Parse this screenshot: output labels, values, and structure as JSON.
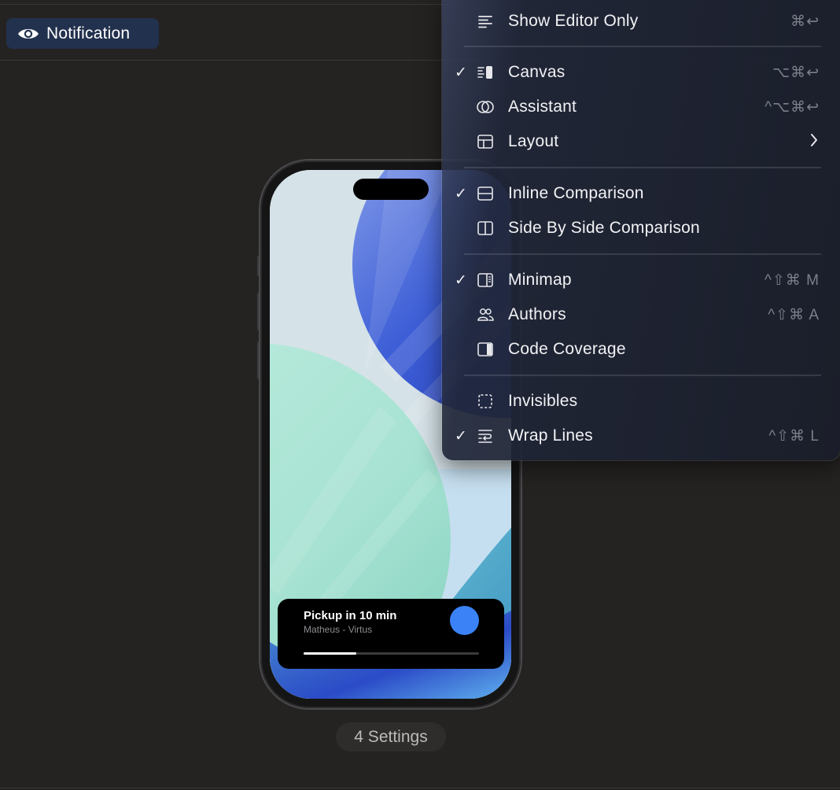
{
  "preview": {
    "mode_label": "Notification",
    "mode_icon": "eye-icon",
    "settings_label": "4 Settings"
  },
  "live_activity": {
    "title": "Pickup in 10 min",
    "subtitle": "Matheus - Virtus",
    "progress_fraction": 0.3,
    "accent_color": "#3b82f6"
  },
  "menu": {
    "items": [
      {
        "label": "Show Editor Only",
        "icon": "editor-lines-icon",
        "checked": false,
        "shortcut": "⌘↩"
      },
      {
        "label": "Canvas",
        "icon": "canvas-icon",
        "checked": true,
        "shortcut": "⌥⌘↩"
      },
      {
        "label": "Assistant",
        "icon": "assistant-circles-icon",
        "checked": false,
        "shortcut": "^⌥⌘↩"
      },
      {
        "label": "Layout",
        "icon": "layout-icon",
        "checked": false,
        "shortcut": "",
        "submenu": true
      },
      {
        "label": "Inline Comparison",
        "icon": "inline-comparison-icon",
        "checked": true,
        "shortcut": ""
      },
      {
        "label": "Side By Side Comparison",
        "icon": "side-by-side-icon",
        "checked": false,
        "shortcut": ""
      },
      {
        "label": "Minimap",
        "icon": "minimap-icon",
        "checked": true,
        "shortcut": "^⇧⌘ M"
      },
      {
        "label": "Authors",
        "icon": "authors-icon",
        "checked": false,
        "shortcut": "^⇧⌘ A"
      },
      {
        "label": "Code Coverage",
        "icon": "code-coverage-icon",
        "checked": false,
        "shortcut": ""
      },
      {
        "label": "Invisibles",
        "icon": "invisibles-icon",
        "checked": false,
        "shortcut": ""
      },
      {
        "label": "Wrap Lines",
        "icon": "wrap-lines-icon",
        "checked": true,
        "shortcut": "^⇧⌘ L"
      }
    ],
    "check_glyph": "✓"
  },
  "colors": {
    "background": "#252322",
    "pill_bg": "#22314d",
    "menu_text": "#f2f2f5",
    "shortcut_text": "#7c7f8a"
  }
}
